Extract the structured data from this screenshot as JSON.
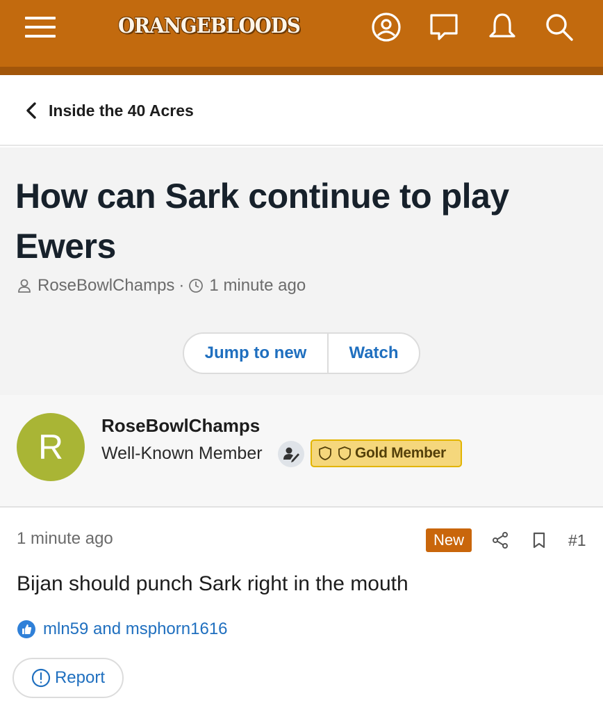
{
  "header": {
    "logo_text": "ORANGEBLOODS",
    "brand_color": "#c26a0e",
    "icons": [
      "menu-icon",
      "account-icon",
      "messages-icon",
      "alerts-icon",
      "search-icon"
    ]
  },
  "breadcrumb": {
    "label": "Inside the 40 Acres"
  },
  "thread": {
    "title": "How can Sark continue to play Ewers",
    "author": "RoseBowlChamps",
    "separator": "·",
    "time": "1 minute ago",
    "buttons": {
      "jump": "Jump to new",
      "watch": "Watch"
    }
  },
  "post_author": {
    "avatar_letter": "R",
    "avatar_color": "#a9b535",
    "name": "RoseBowlChamps",
    "user_title": "Well-Known Member",
    "badge": "Gold Member"
  },
  "post": {
    "time": "1 minute ago",
    "new_badge": "New",
    "number": "#1",
    "body": "Bijan should punch Sark right in the mouth",
    "reactions": "mln59 and msphorn1616",
    "report_label": "Report"
  }
}
